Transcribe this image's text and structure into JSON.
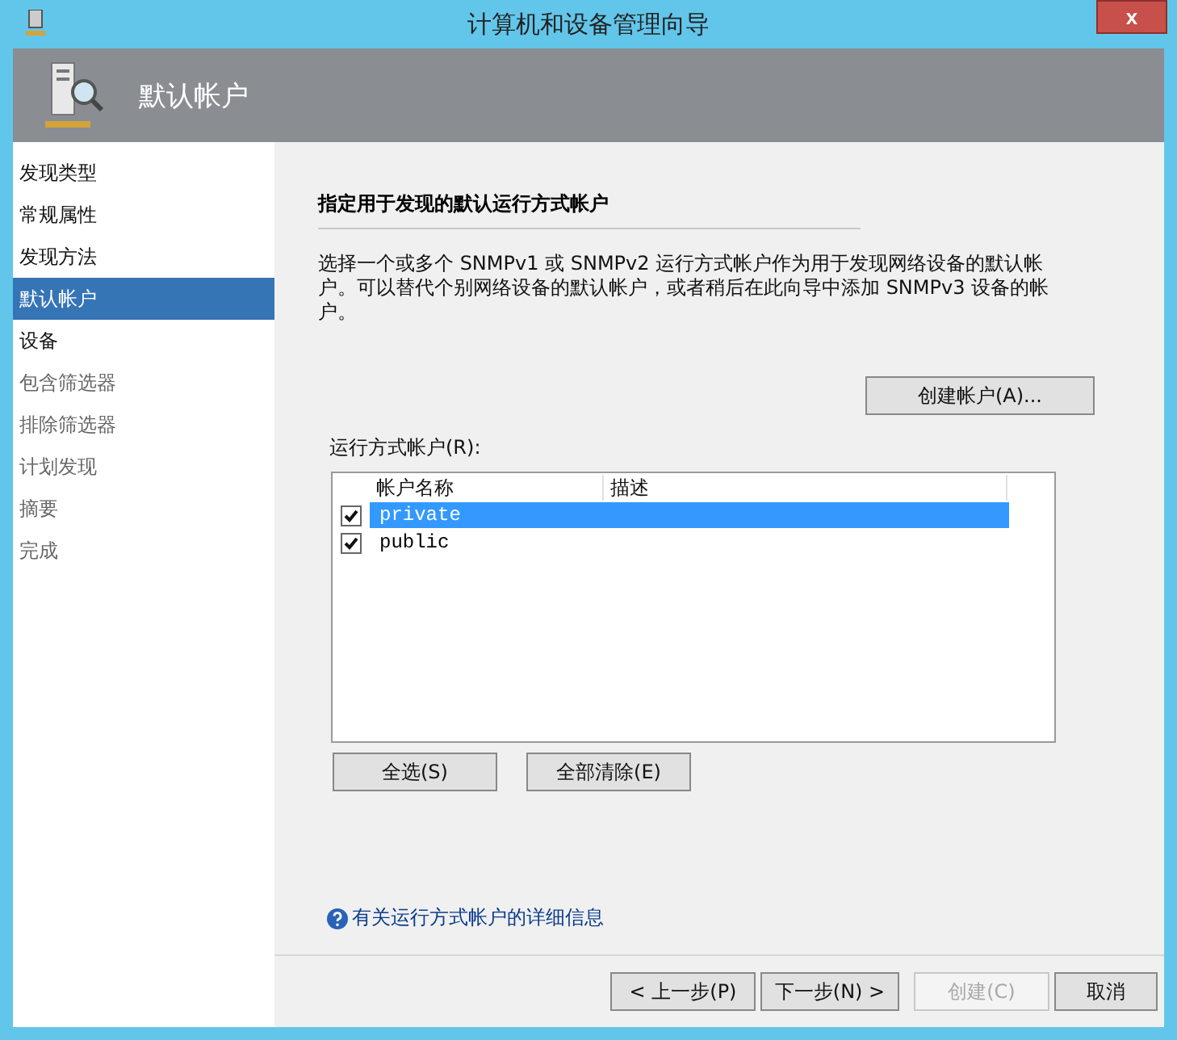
{
  "window": {
    "title": "计算机和设备管理向导",
    "close": "x"
  },
  "header": {
    "title": "默认帐户"
  },
  "sidebar": {
    "items": [
      {
        "label": "发现类型",
        "selected": false,
        "disabled": false
      },
      {
        "label": "常规属性",
        "selected": false,
        "disabled": false
      },
      {
        "label": "发现方法",
        "selected": false,
        "disabled": false
      },
      {
        "label": "默认帐户",
        "selected": true,
        "disabled": false
      },
      {
        "label": "设备",
        "selected": false,
        "disabled": false
      },
      {
        "label": "包含筛选器",
        "selected": false,
        "disabled": true
      },
      {
        "label": "排除筛选器",
        "selected": false,
        "disabled": true
      },
      {
        "label": "计划发现",
        "selected": false,
        "disabled": true
      },
      {
        "label": "摘要",
        "selected": false,
        "disabled": true
      },
      {
        "label": "完成",
        "selected": false,
        "disabled": true
      }
    ]
  },
  "content": {
    "heading": "指定用于发现的默认运行方式帐户",
    "description": "选择一个或多个 SNMPv1 或 SNMPv2 运行方式帐户作为用于发现网络设备的默认帐户。可以替代个别网络设备的默认帐户，或者稍后在此向导中添加 SNMPv3 设备的帐户。",
    "create_button": "创建帐户(A)...",
    "list_label": "运行方式帐户(R):",
    "table": {
      "columns": [
        "帐户名称",
        "描述"
      ],
      "rows": [
        {
          "name": "private",
          "checked": true,
          "selected": true
        },
        {
          "name": "public",
          "checked": true,
          "selected": false
        }
      ]
    },
    "select_all": "全选(S)",
    "clear_all": "全部清除(E)",
    "help_link": "有关运行方式帐户的详细信息"
  },
  "footer": {
    "buttons": [
      {
        "label": "< 上一步(P)",
        "disabled": false
      },
      {
        "label": "下一步(N) >",
        "disabled": false
      },
      {
        "label": "创建(C)",
        "disabled": true
      },
      {
        "label": "取消",
        "disabled": false
      }
    ]
  }
}
